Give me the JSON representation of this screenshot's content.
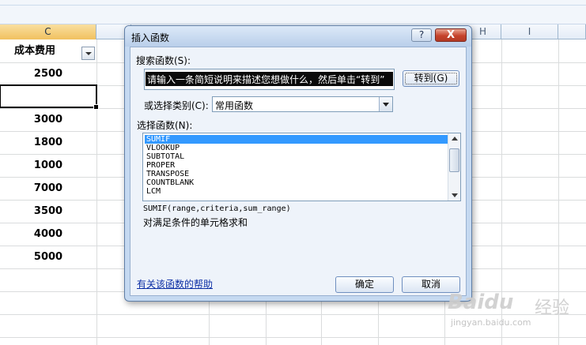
{
  "spreadsheet": {
    "columns": [
      {
        "label": "C",
        "selected": true
      },
      {
        "label": "H",
        "selected": false
      },
      {
        "label": "I",
        "selected": false
      }
    ],
    "header_cell": "成本费用",
    "values": [
      "2500",
      "",
      "3000",
      "1800",
      "1000",
      "7000",
      "3500",
      "4000",
      "5000"
    ]
  },
  "dialog": {
    "title": "插入函数",
    "help_button": "?",
    "close_button": "X",
    "search_label": "搜索函数(S):",
    "search_value": "请输入一条简短说明来描述您想做什么，然后单击“转到”",
    "goto_button": "转到(G)",
    "category_label": "或选择类别(C):",
    "category_value": "常用函数",
    "function_label": "选择函数(N):",
    "functions": [
      "SUMIF",
      "VLOOKUP",
      "SUBTOTAL",
      "PROPER",
      "TRANSPOSE",
      "COUNTBLANK",
      "LCM"
    ],
    "selected_function": "SUMIF",
    "signature": "SUMIF(range,criteria,sum_range)",
    "description": "对满足条件的单元格求和",
    "help_link": "有关该函数的帮助",
    "ok_button": "确定",
    "cancel_button": "取消"
  },
  "watermark": {
    "brand": "Baidu",
    "text": "经验",
    "url": "jingyan.baidu.com"
  }
}
